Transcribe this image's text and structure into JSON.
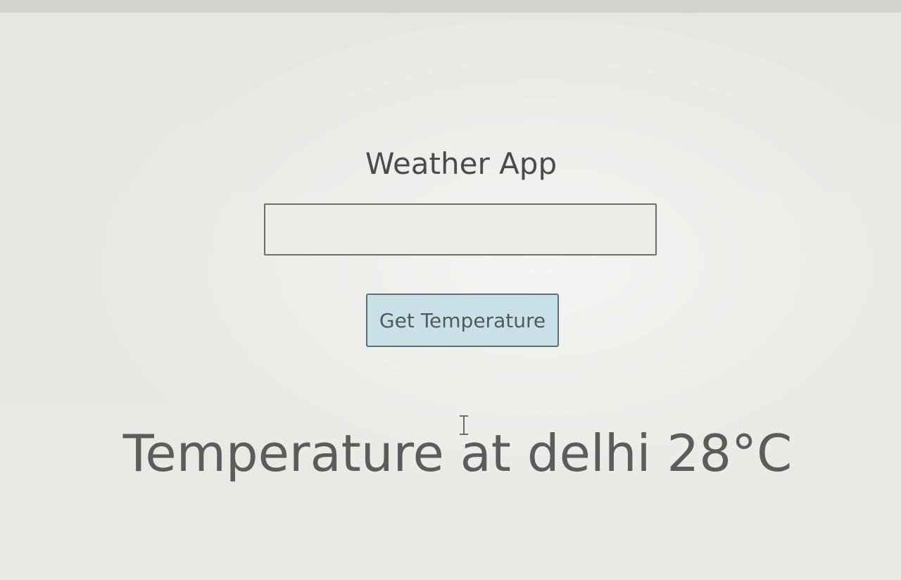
{
  "app": {
    "title": "Weather App"
  },
  "city_input": {
    "value": "",
    "placeholder": ""
  },
  "get_button": {
    "label": "Get Temperature"
  },
  "result": {
    "text": "Temperature at delhi 28°C"
  },
  "pointer": {
    "icon": "text-cursor-icon"
  },
  "colors": {
    "button_background": "#c9e1e6",
    "page_background": "#e8e8e4",
    "text": "#4b4b4b"
  }
}
